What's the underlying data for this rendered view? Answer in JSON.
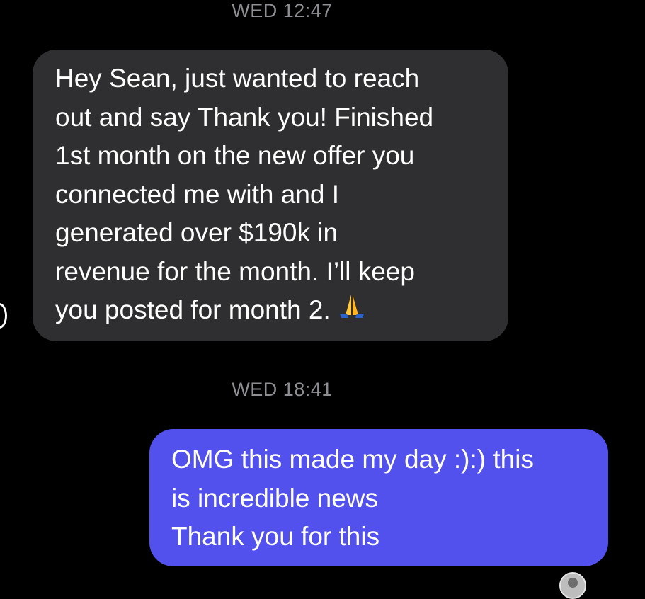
{
  "conversation": {
    "messages": [
      {
        "timestamp": "WED 12:47",
        "direction": "incoming",
        "text": "Hey Sean, just wanted to reach\nout and say Thank you! Finished\n1st month on the new offer you\nconnected me with and I\ngenerated over $190k in\nrevenue for the month. I’ll keep\nyou posted for month 2.",
        "emoji": "🙏",
        "bubble_color": "#2f2f31"
      },
      {
        "timestamp": "WED 18:41",
        "direction": "outgoing",
        "text": "OMG this made my day :):) this\nis incredible news\nThank you for this",
        "bubble_color": "#5351ed"
      }
    ]
  },
  "icons": {
    "sender_avatar": "avatar-icon",
    "read_receipt": "read-receipt-avatar-icon"
  }
}
